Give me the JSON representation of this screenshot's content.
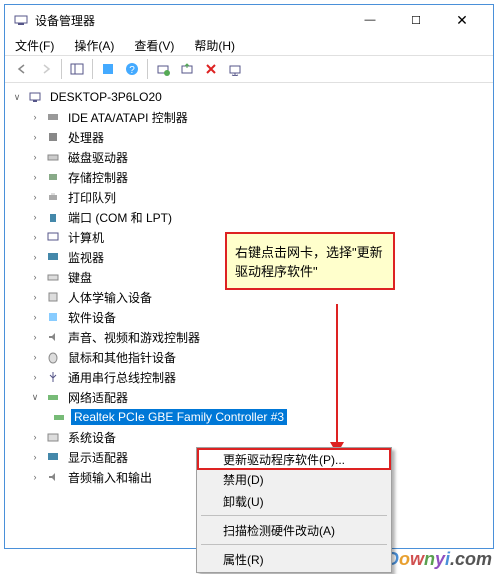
{
  "window": {
    "title": "设备管理器",
    "min": "—",
    "max": "☐",
    "close": "✕"
  },
  "menu": {
    "file": "文件(F)",
    "action": "操作(A)",
    "view": "查看(V)",
    "help": "帮助(H)"
  },
  "tree": {
    "root": "DESKTOP-3P6LO20",
    "items": [
      "IDE ATA/ATAPI 控制器",
      "处理器",
      "磁盘驱动器",
      "存储控制器",
      "打印队列",
      "端口 (COM 和 LPT)",
      "计算机",
      "监视器",
      "键盘",
      "人体学输入设备",
      "软件设备",
      "声音、视频和游戏控制器",
      "鼠标和其他指针设备",
      "通用串行总线控制器",
      "网络适配器",
      "系统设备",
      "显示适配器",
      "音频输入和输出"
    ],
    "selected": "Realtek PCIe GBE Family Controller #3"
  },
  "context": {
    "update": "更新驱动程序软件(P)...",
    "disable": "禁用(D)",
    "uninstall": "卸载(U)",
    "scan": "扫描检测硬件改动(A)",
    "properties": "属性(R)"
  },
  "callout": {
    "text": "右键点击网卡，选择\"更新驱动程序软件\""
  },
  "watermark": "Downyi.com"
}
